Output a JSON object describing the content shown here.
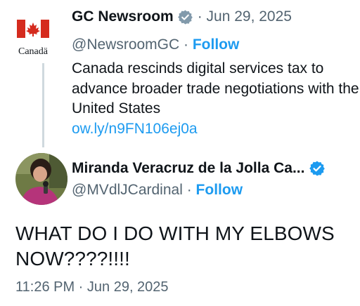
{
  "parent_tweet": {
    "logo_text": "Canadä",
    "display_name": "GC Newsroom",
    "badge_icon": "government-badge-icon",
    "date_meta": "· Jun 29, 2025",
    "handle": "@NewsroomGC",
    "separator": "·",
    "follow_label": "Follow",
    "text": "Canada rescinds digital services tax to advance broader trade negotiations with the United States",
    "link": "ow.ly/n9FN106ej0a"
  },
  "reply_tweet": {
    "display_name": "Miranda Veracruz de la Jolla Ca...",
    "badge_icon": "verified-badge-icon",
    "handle": "@MVdlJCardinal",
    "separator": "·",
    "follow_label": "Follow",
    "text": "WHAT DO I DO WITH MY ELBOWS NOW????!!!!",
    "timestamp": "11:26 PM · Jun 29, 2025"
  },
  "colors": {
    "accent": "#1d9bf0",
    "secondary_text": "#536471",
    "primary_text": "#0f1419",
    "canada_red": "#d52b1e",
    "gov_badge_gray": "#829aab"
  }
}
